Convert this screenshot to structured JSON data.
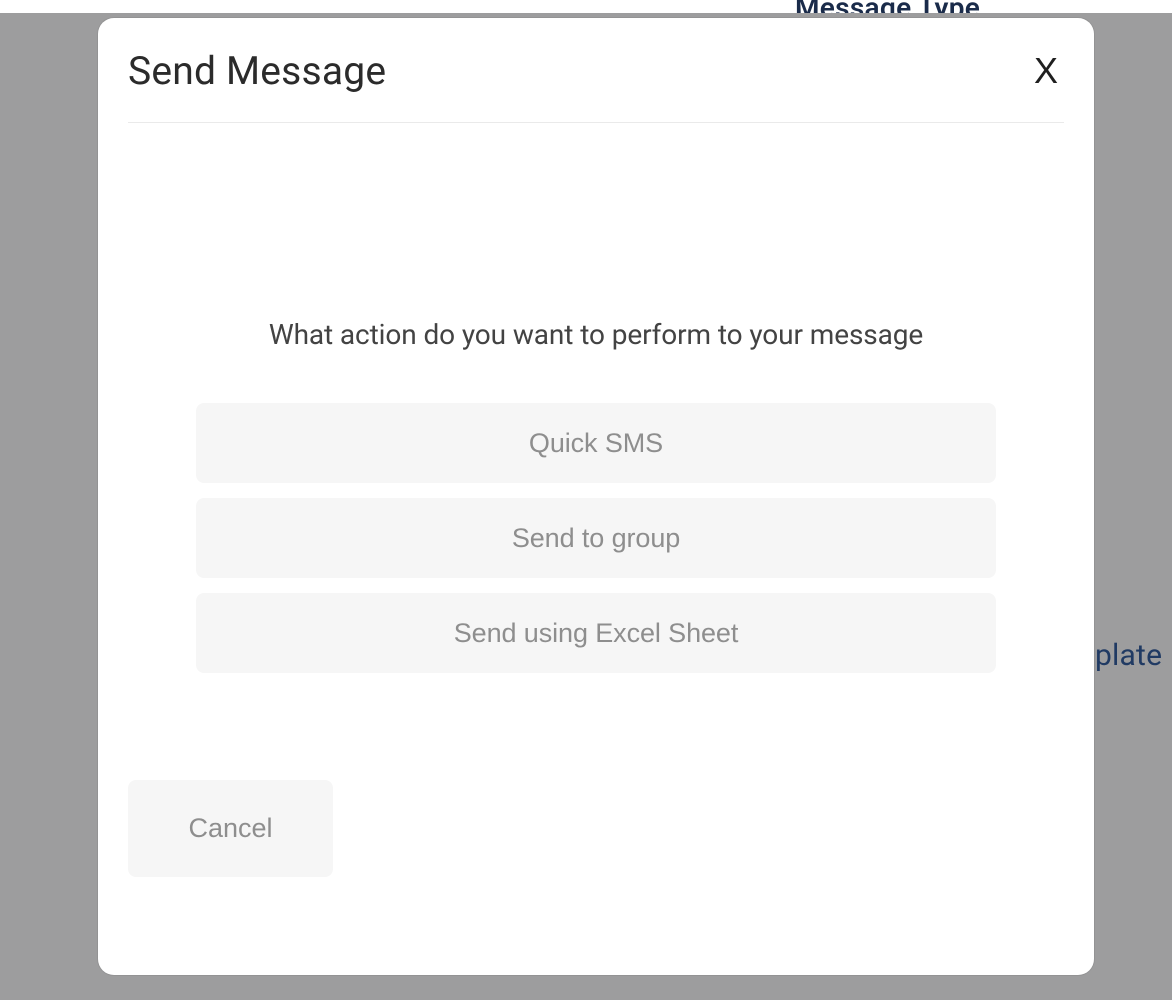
{
  "background": {
    "top_label": "Message Type",
    "right_label_fragment": "plate"
  },
  "modal": {
    "title": "Send Message",
    "close_glyph": "X",
    "prompt": "What action do you want to perform to your message",
    "options": [
      {
        "label": "Quick SMS"
      },
      {
        "label": "Send to group"
      },
      {
        "label": "Send using Excel Sheet"
      }
    ],
    "cancel_label": "Cancel"
  }
}
